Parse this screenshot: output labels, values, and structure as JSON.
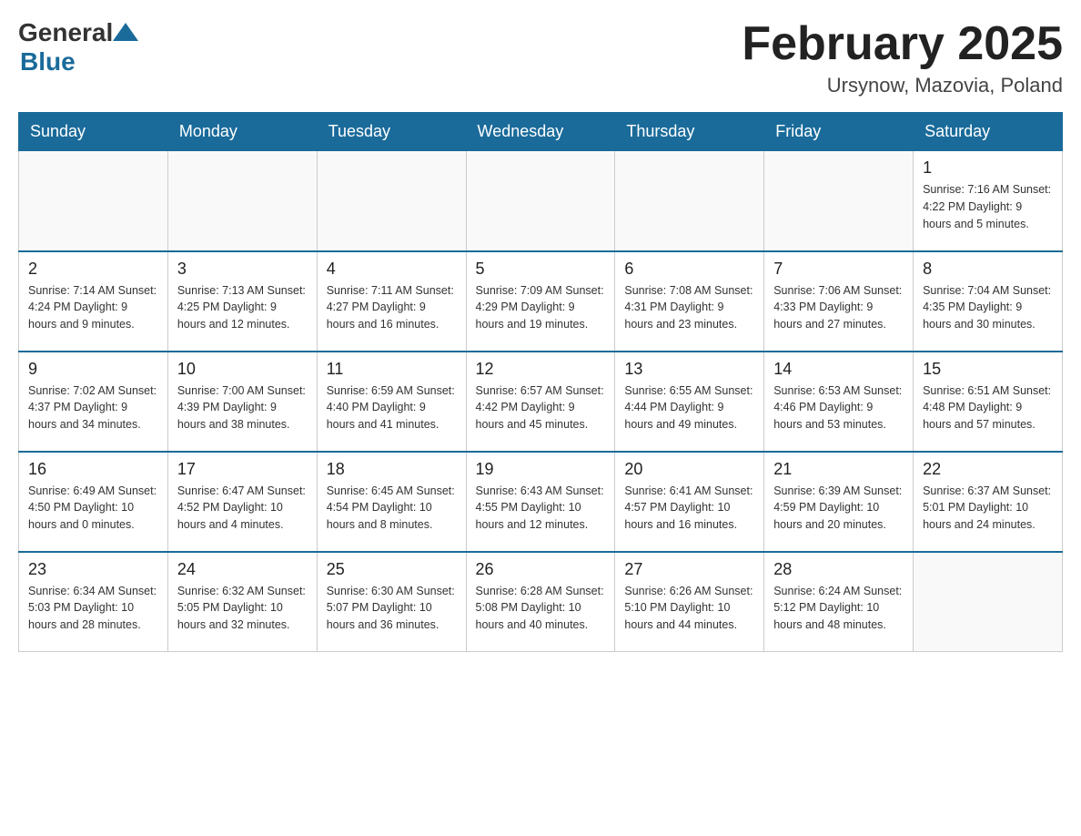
{
  "header": {
    "logo_general": "General",
    "logo_blue": "Blue",
    "month_title": "February 2025",
    "location": "Ursynow, Mazovia, Poland"
  },
  "days_of_week": [
    "Sunday",
    "Monday",
    "Tuesday",
    "Wednesday",
    "Thursday",
    "Friday",
    "Saturday"
  ],
  "weeks": [
    {
      "days": [
        {
          "number": "",
          "info": ""
        },
        {
          "number": "",
          "info": ""
        },
        {
          "number": "",
          "info": ""
        },
        {
          "number": "",
          "info": ""
        },
        {
          "number": "",
          "info": ""
        },
        {
          "number": "",
          "info": ""
        },
        {
          "number": "1",
          "info": "Sunrise: 7:16 AM\nSunset: 4:22 PM\nDaylight: 9 hours and 5 minutes."
        }
      ]
    },
    {
      "days": [
        {
          "number": "2",
          "info": "Sunrise: 7:14 AM\nSunset: 4:24 PM\nDaylight: 9 hours and 9 minutes."
        },
        {
          "number": "3",
          "info": "Sunrise: 7:13 AM\nSunset: 4:25 PM\nDaylight: 9 hours and 12 minutes."
        },
        {
          "number": "4",
          "info": "Sunrise: 7:11 AM\nSunset: 4:27 PM\nDaylight: 9 hours and 16 minutes."
        },
        {
          "number": "5",
          "info": "Sunrise: 7:09 AM\nSunset: 4:29 PM\nDaylight: 9 hours and 19 minutes."
        },
        {
          "number": "6",
          "info": "Sunrise: 7:08 AM\nSunset: 4:31 PM\nDaylight: 9 hours and 23 minutes."
        },
        {
          "number": "7",
          "info": "Sunrise: 7:06 AM\nSunset: 4:33 PM\nDaylight: 9 hours and 27 minutes."
        },
        {
          "number": "8",
          "info": "Sunrise: 7:04 AM\nSunset: 4:35 PM\nDaylight: 9 hours and 30 minutes."
        }
      ]
    },
    {
      "days": [
        {
          "number": "9",
          "info": "Sunrise: 7:02 AM\nSunset: 4:37 PM\nDaylight: 9 hours and 34 minutes."
        },
        {
          "number": "10",
          "info": "Sunrise: 7:00 AM\nSunset: 4:39 PM\nDaylight: 9 hours and 38 minutes."
        },
        {
          "number": "11",
          "info": "Sunrise: 6:59 AM\nSunset: 4:40 PM\nDaylight: 9 hours and 41 minutes."
        },
        {
          "number": "12",
          "info": "Sunrise: 6:57 AM\nSunset: 4:42 PM\nDaylight: 9 hours and 45 minutes."
        },
        {
          "number": "13",
          "info": "Sunrise: 6:55 AM\nSunset: 4:44 PM\nDaylight: 9 hours and 49 minutes."
        },
        {
          "number": "14",
          "info": "Sunrise: 6:53 AM\nSunset: 4:46 PM\nDaylight: 9 hours and 53 minutes."
        },
        {
          "number": "15",
          "info": "Sunrise: 6:51 AM\nSunset: 4:48 PM\nDaylight: 9 hours and 57 minutes."
        }
      ]
    },
    {
      "days": [
        {
          "number": "16",
          "info": "Sunrise: 6:49 AM\nSunset: 4:50 PM\nDaylight: 10 hours and 0 minutes."
        },
        {
          "number": "17",
          "info": "Sunrise: 6:47 AM\nSunset: 4:52 PM\nDaylight: 10 hours and 4 minutes."
        },
        {
          "number": "18",
          "info": "Sunrise: 6:45 AM\nSunset: 4:54 PM\nDaylight: 10 hours and 8 minutes."
        },
        {
          "number": "19",
          "info": "Sunrise: 6:43 AM\nSunset: 4:55 PM\nDaylight: 10 hours and 12 minutes."
        },
        {
          "number": "20",
          "info": "Sunrise: 6:41 AM\nSunset: 4:57 PM\nDaylight: 10 hours and 16 minutes."
        },
        {
          "number": "21",
          "info": "Sunrise: 6:39 AM\nSunset: 4:59 PM\nDaylight: 10 hours and 20 minutes."
        },
        {
          "number": "22",
          "info": "Sunrise: 6:37 AM\nSunset: 5:01 PM\nDaylight: 10 hours and 24 minutes."
        }
      ]
    },
    {
      "days": [
        {
          "number": "23",
          "info": "Sunrise: 6:34 AM\nSunset: 5:03 PM\nDaylight: 10 hours and 28 minutes."
        },
        {
          "number": "24",
          "info": "Sunrise: 6:32 AM\nSunset: 5:05 PM\nDaylight: 10 hours and 32 minutes."
        },
        {
          "number": "25",
          "info": "Sunrise: 6:30 AM\nSunset: 5:07 PM\nDaylight: 10 hours and 36 minutes."
        },
        {
          "number": "26",
          "info": "Sunrise: 6:28 AM\nSunset: 5:08 PM\nDaylight: 10 hours and 40 minutes."
        },
        {
          "number": "27",
          "info": "Sunrise: 6:26 AM\nSunset: 5:10 PM\nDaylight: 10 hours and 44 minutes."
        },
        {
          "number": "28",
          "info": "Sunrise: 6:24 AM\nSunset: 5:12 PM\nDaylight: 10 hours and 48 minutes."
        },
        {
          "number": "",
          "info": ""
        }
      ]
    }
  ]
}
